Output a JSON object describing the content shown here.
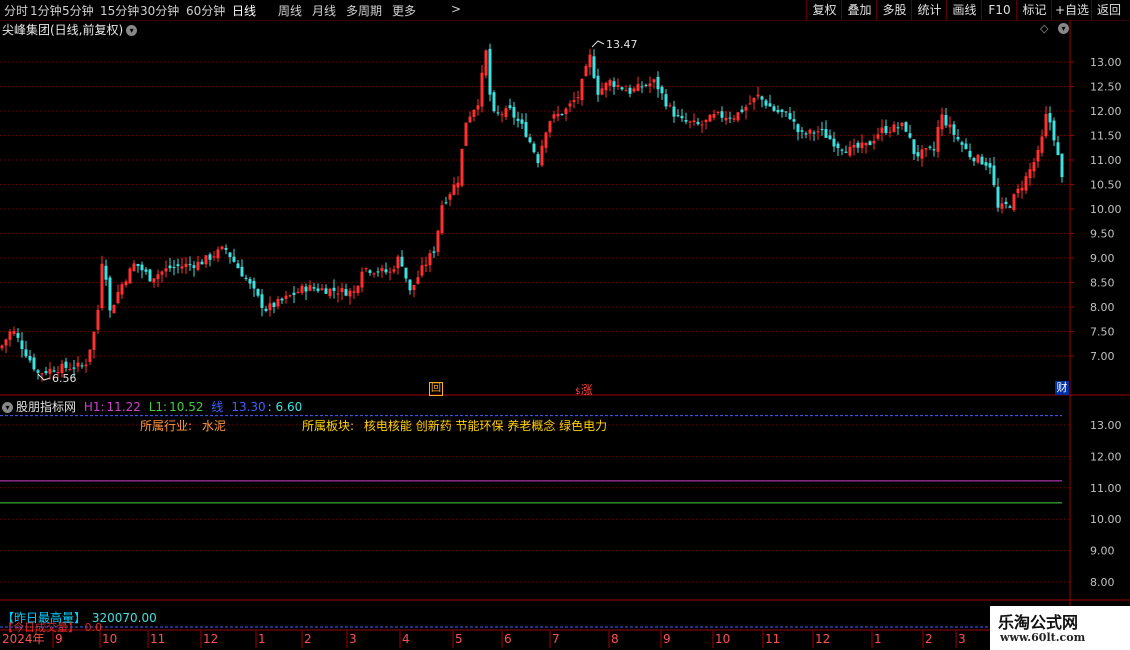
{
  "toolbar": {
    "periods": [
      "分时",
      "1分钟",
      "5分钟",
      "15分钟",
      "30分钟",
      "60分钟",
      "日线",
      "周线",
      "月线",
      "多周期",
      "更多"
    ],
    "active_period": "日线",
    "more_arrow": ">",
    "buttons": [
      "复权",
      "叠加",
      "多股",
      "统计",
      "画线",
      "F10",
      "标记",
      "+自选",
      "返回"
    ]
  },
  "main_chart": {
    "title": "尖峰集团(日线,前复权)",
    "high_label": "13.47",
    "low_label": "6.56",
    "y_ticks": [
      "13.00",
      "12.50",
      "12.00",
      "11.50",
      "11.00",
      "10.50",
      "10.00",
      "9.50",
      "9.00",
      "8.50",
      "8.00",
      "7.50",
      "7.00"
    ],
    "markers": [
      {
        "text": "回",
        "color": "#ffb020"
      },
      {
        "text": "涨",
        "color": "#ff4040"
      },
      {
        "text": "财",
        "color": "#ffffff"
      }
    ],
    "candle_up_color": "#ff3030",
    "candle_down_color": "#40e0e0"
  },
  "indicator": {
    "name": "股朋指标网",
    "h1_label": "H1:",
    "h1_value": "11.22",
    "l1_label": "L1:",
    "l1_value": "10.52",
    "line_label": "线",
    "line_value": "13.30",
    "extra_value": ": 6.60",
    "industry_label": "所属行业:",
    "industry_value": "水泥",
    "sector_label": "所属板块:",
    "sector_value": "核电核能 创新药 节能环保 养老概念 绿色电力",
    "y_ticks": [
      "13.00",
      "12.00",
      "11.00",
      "10.00",
      "9.00",
      "8.00"
    ],
    "h1_color": "#d040d0",
    "l1_color": "#40d040",
    "line_color": "#4060ff"
  },
  "bottom": {
    "label": "【昨日最高量】",
    "value": "320070.00",
    "sub_label": "【今日成交量】",
    "sub_value": "0.0"
  },
  "time_axis": {
    "year": "2024年",
    "months": [
      "9",
      "10",
      "11",
      "12",
      "1",
      "2",
      "3",
      "4",
      "5",
      "6",
      "7",
      "8",
      "9",
      "10",
      "11",
      "12",
      "1",
      "2",
      "3"
    ]
  },
  "watermark": {
    "title": "乐淘公式网",
    "url": "www.60lt.com"
  }
}
